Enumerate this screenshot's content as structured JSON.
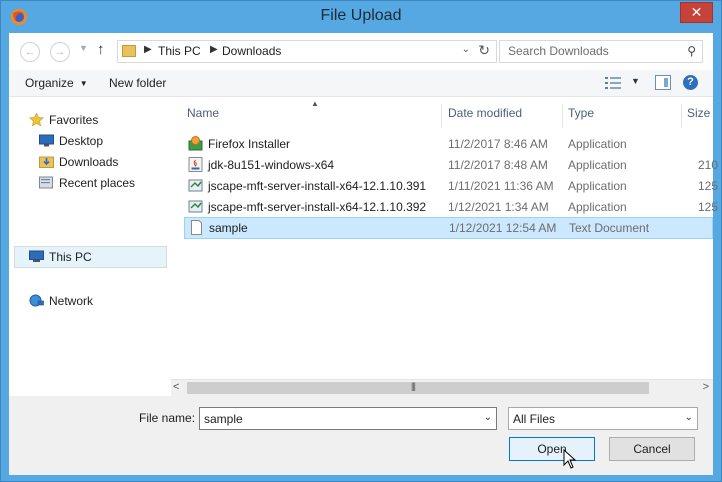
{
  "window": {
    "title": "File Upload",
    "close_glyph": "✕"
  },
  "address": {
    "back_glyph": "←",
    "forward_glyph": "→",
    "up_glyph": "↑",
    "crumbs": [
      "This PC",
      "Downloads"
    ],
    "search_placeholder": "Search Downloads"
  },
  "toolbar": {
    "organize": "Organize",
    "new_folder": "New folder",
    "help_glyph": "?"
  },
  "sidebar": {
    "items": [
      {
        "label": "Favorites",
        "icon": "star-icon"
      },
      {
        "label": "Desktop",
        "icon": "desktop-icon"
      },
      {
        "label": "Downloads",
        "icon": "downloads-folder-icon"
      },
      {
        "label": "Recent places",
        "icon": "recent-places-icon"
      },
      {
        "label": "This PC",
        "icon": "computer-icon"
      },
      {
        "label": "Network",
        "icon": "network-icon"
      }
    ]
  },
  "files": {
    "columns": [
      "Name",
      "Date modified",
      "Type",
      "Size"
    ],
    "rows": [
      {
        "name": "Firefox Installer",
        "date": "11/2/2017 8:46 AM",
        "type": "Application",
        "size": "",
        "icon": "firefox-installer-icon"
      },
      {
        "name": "jdk-8u151-windows-x64",
        "date": "11/2/2017 8:48 AM",
        "type": "Application",
        "size": "210",
        "icon": "java-installer-icon"
      },
      {
        "name": "jscape-mft-server-install-x64-12.1.10.391",
        "date": "1/11/2021 11:36 AM",
        "type": "Application",
        "size": "125",
        "icon": "installer-icon"
      },
      {
        "name": "jscape-mft-server-install-x64-12.1.10.392",
        "date": "1/12/2021 1:34 AM",
        "type": "Application",
        "size": "125",
        "icon": "installer-icon"
      },
      {
        "name": "sample",
        "date": "1/12/2021 12:54 AM",
        "type": "Text Document",
        "size": "",
        "icon": "text-file-icon"
      }
    ]
  },
  "bottom": {
    "file_name_label": "File name:",
    "file_name_value": "sample",
    "filter_value": "All Files",
    "open_label": "Open",
    "cancel_label": "Cancel"
  }
}
